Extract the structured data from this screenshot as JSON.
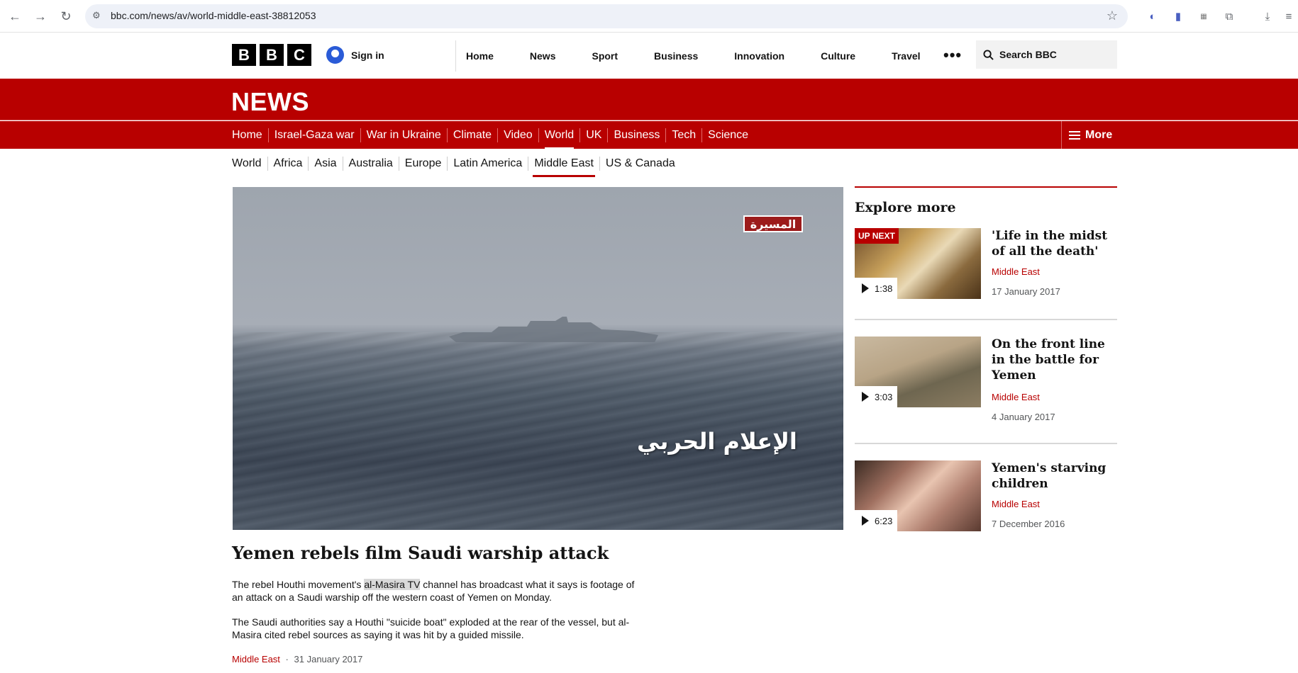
{
  "browser": {
    "url": "bbc.com/news/av/world-middle-east-38812053"
  },
  "bbc_header": {
    "logo_letters": [
      "B",
      "B",
      "C"
    ],
    "signin_label": "Sign in",
    "nav": [
      "Home",
      "News",
      "Sport",
      "Business",
      "Innovation",
      "Culture",
      "Travel"
    ],
    "more_label": "•••",
    "search_label": "Search BBC"
  },
  "news_header": {
    "title": "NEWS",
    "nav": [
      "Home",
      "Israel-Gaza war",
      "War in Ukraine",
      "Climate",
      "Video",
      "World",
      "UK",
      "Business",
      "Tech",
      "Science"
    ],
    "active": "World",
    "more_label": "More"
  },
  "sub_nav": {
    "items": [
      "World",
      "Africa",
      "Asia",
      "Australia",
      "Europe",
      "Latin America",
      "Middle East",
      "US & Canada"
    ],
    "active": "Middle East"
  },
  "video": {
    "channel_logo": "المسيرة",
    "caption": "الإعلام الحربي"
  },
  "article": {
    "headline": "Yemen rebels film Saudi warship attack",
    "para1_a": "The rebel Houthi movement's ",
    "para1_highlight": "al-Masira TV",
    "para1_b": " channel has broadcast what it says is footage of an attack on a Saudi warship off the western coast of Yemen on Monday.",
    "para2": "The Saudi authorities say a Houthi \"suicide boat\" exploded at the rear of the vessel, but al-Masira cited rebel sources as saying it was hit by a guided missile.",
    "tag": "Middle East",
    "separator": "·",
    "date": "31 January 2017"
  },
  "explore": {
    "title": "Explore more",
    "up_next_label": "UP NEXT",
    "cards": [
      {
        "title": "'Life in the midst of all the death'",
        "tag": "Middle East",
        "date": "17 January 2017",
        "duration": "1:38"
      },
      {
        "title": "On the front line in the battle for Yemen",
        "tag": "Middle East",
        "date": "4 January 2017",
        "duration": "3:03"
      },
      {
        "title": "Yemen's starving children",
        "tag": "Middle East",
        "date": "7 December 2016",
        "duration": "6:23"
      }
    ]
  }
}
